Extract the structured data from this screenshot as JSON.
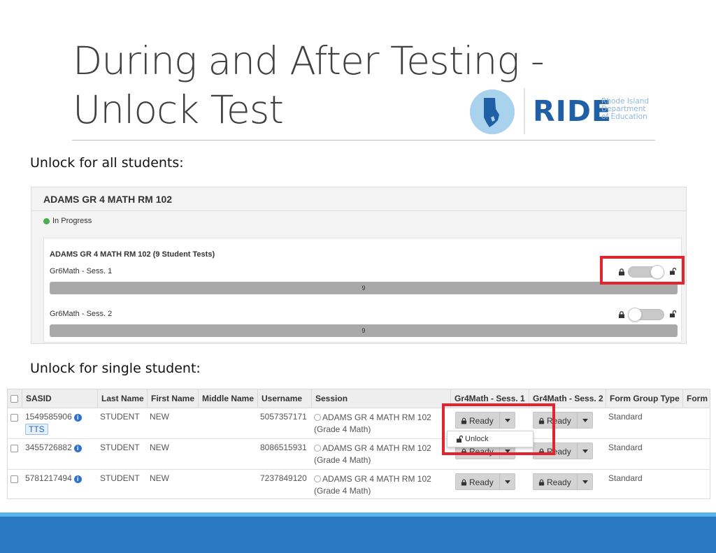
{
  "slide": {
    "title_line1": "During and After Testing -",
    "title_line2": "Unlock Test"
  },
  "logo": {
    "name": "RIDE",
    "sub1": "Rhode Island",
    "sub2": "Department",
    "sub3": "of Education"
  },
  "section_all": "Unlock for all students:",
  "section_single": "Unlock for single student:",
  "panel": {
    "title": "ADAMS GR 4 MATH RM 102",
    "status": "In Progress",
    "status_color": "#4cae4c",
    "card_title": "ADAMS GR 4 MATH RM 102 (9 Student Tests)",
    "sessions": [
      {
        "name": "Gr6Math - Sess. 1",
        "count": "9",
        "toggle": "unlocked"
      },
      {
        "name": "Gr6Math - Sess. 2",
        "count": "9",
        "toggle": "locked"
      }
    ]
  },
  "table": {
    "headers": [
      "SASID",
      "Last Name",
      "First Name",
      "Middle Name",
      "Username",
      "Session",
      "Gr4Math - Sess. 1",
      "Gr4Math - Sess. 2",
      "Form Group Type",
      "Form"
    ],
    "rows": [
      {
        "sasid": "1549585906",
        "tag": "TTS",
        "last": "STUDENT",
        "first": "NEW",
        "middle": "",
        "username": "5057357171",
        "session": "ADAMS GR 4 MATH RM 102",
        "session_sub": "(Grade 4 Math)",
        "s1": "Ready",
        "s2": "Ready",
        "form_group": "Standard"
      },
      {
        "sasid": "3455726882",
        "tag": "",
        "last": "STUDENT",
        "first": "NEW",
        "middle": "",
        "username": "8086515931",
        "session": "ADAMS GR 4 MATH RM 102",
        "session_sub": "(Grade 4 Math)",
        "s1": "Ready",
        "s2": "Ready",
        "form_group": "Standard"
      },
      {
        "sasid": "5781217494",
        "tag": "",
        "last": "STUDENT",
        "first": "NEW",
        "middle": "",
        "username": "7237849120",
        "session": "ADAMS GR 4 MATH RM 102",
        "session_sub": "(Grade 4 Math)",
        "s1": "Ready",
        "s2": "Ready",
        "form_group": "Standard"
      }
    ],
    "dropdown_item": "Unlock"
  },
  "colors": {
    "highlight": "#e2242e",
    "footer": "#2a78c4",
    "accent": "#1f5fa5"
  }
}
